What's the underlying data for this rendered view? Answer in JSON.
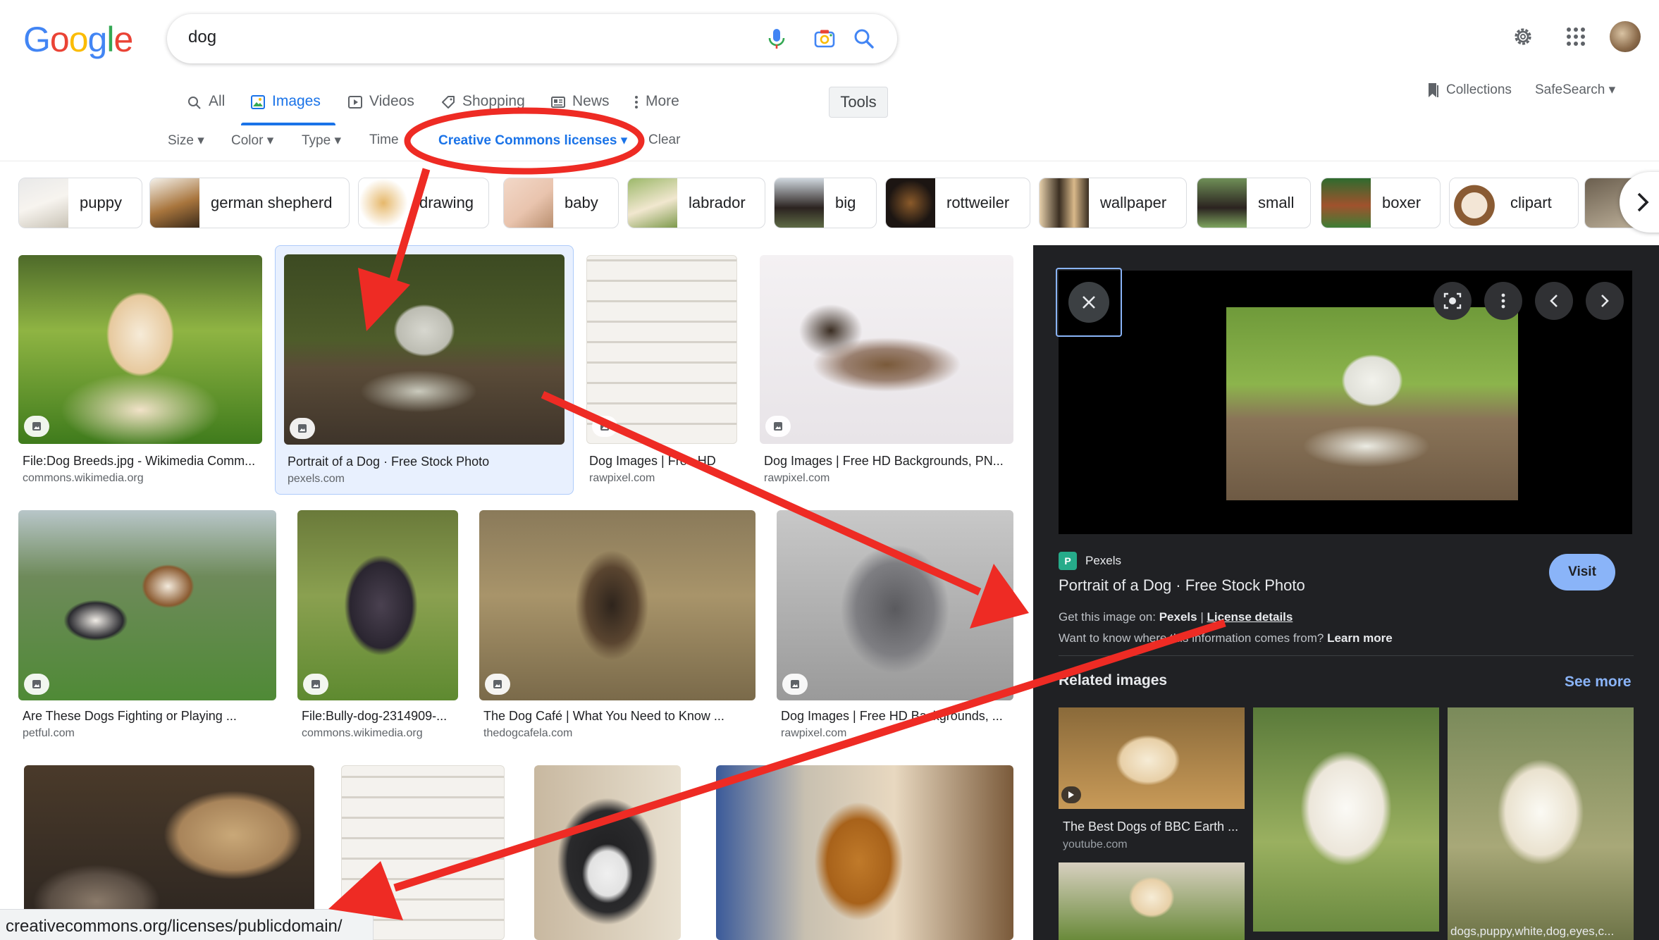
{
  "logo": {
    "letters": [
      "G",
      "o",
      "o",
      "g",
      "l",
      "e"
    ],
    "colors": [
      "#4285f4",
      "#ea4335",
      "#fbbc05",
      "#4285f4",
      "#34a853",
      "#ea4335"
    ]
  },
  "search": {
    "query": "dog"
  },
  "tabs": [
    {
      "label": "All",
      "icon": "search-icon"
    },
    {
      "label": "Images",
      "icon": "image-icon"
    },
    {
      "label": "Videos",
      "icon": "play-icon"
    },
    {
      "label": "Shopping",
      "icon": "tag-icon"
    },
    {
      "label": "News",
      "icon": "news-icon"
    },
    {
      "label": "More",
      "icon": "more-vert-icon"
    }
  ],
  "tools_label": "Tools",
  "collections_label": "Collections",
  "safesearch_label": "SafeSearch",
  "filters": {
    "size": "Size",
    "color": "Color",
    "type": "Type",
    "time": "Time",
    "license": "Creative Commons licenses",
    "clear": "Clear"
  },
  "chips": [
    "puppy",
    "german shepherd",
    "drawing",
    "baby",
    "labrador",
    "big",
    "rottweiler",
    "wallpaper",
    "small",
    "boxer",
    "clipart"
  ],
  "results": [
    {
      "title": "File:Dog Breeds.jpg - Wikimedia Comm...",
      "source": "commons.wikimedia.org"
    },
    {
      "title": "Portrait of a Dog · Free Stock Photo",
      "source": "pexels.com"
    },
    {
      "title": "Dog Images | Free HD",
      "source": "rawpixel.com"
    },
    {
      "title": "Dog Images | Free HD Backgrounds, PN...",
      "source": "rawpixel.com"
    },
    {
      "title": "Are These Dogs Fighting or Playing ...",
      "source": "petful.com"
    },
    {
      "title": "File:Bully-dog-2314909-...",
      "source": "commons.wikimedia.org"
    },
    {
      "title": "The Dog Café | What You Need to Know ...",
      "source": "thedogcafela.com"
    },
    {
      "title": "Dog Images | Free HD Backgrounds, ...",
      "source": "rawpixel.com"
    }
  ],
  "panel": {
    "source_name": "Pexels",
    "source_initial": "P",
    "title": "Portrait of a Dog · Free Stock Photo",
    "visit": "Visit",
    "get_prefix": "Get this image on:",
    "get_site": "Pexels",
    "license_details": "License details",
    "want_prefix": "Want to know where this information comes from?",
    "learn_more": "Learn more",
    "related_heading": "Related images",
    "see_more": "See more",
    "related": [
      {
        "caption": "The Best Dogs of BBC Earth ...",
        "source": "youtube.com"
      },
      {
        "caption": "dogs,puppy,white,dog,eyes,c..."
      }
    ]
  },
  "status_url": "creativecommons.org/licenses/publicdomain/",
  "annotation_color": "#ee2b24"
}
